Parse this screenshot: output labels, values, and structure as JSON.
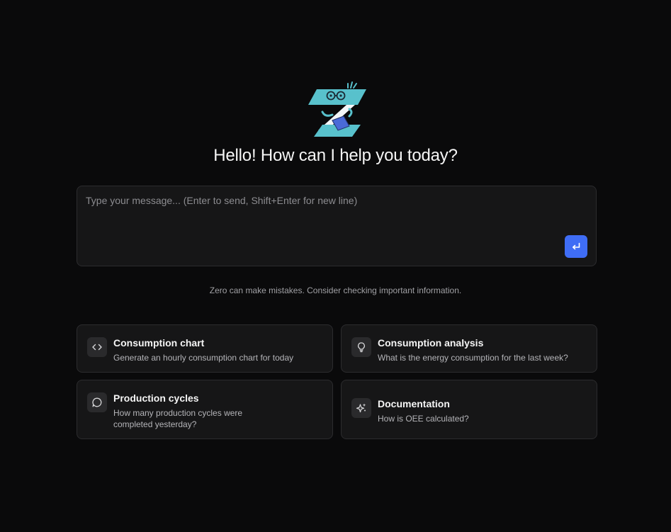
{
  "header": {
    "logo": "zero-mascot-logo",
    "greeting": "Hello! How can I help you today?"
  },
  "composer": {
    "placeholder": "Type your message... (Enter to send, Shift+Enter for new line)",
    "value": "",
    "send_icon": "enter-return-icon",
    "accent_color": "#3f6df5"
  },
  "disclaimer": "Zero can make mistakes. Consider checking important information.",
  "suggestions": [
    {
      "icon": "code-icon",
      "title": "Consumption chart",
      "subtitle": "Generate an hourly consumption chart for today"
    },
    {
      "icon": "lightbulb-icon",
      "title": "Consumption analysis",
      "subtitle": "What is the energy consumption for the last week?"
    },
    {
      "icon": "chat-bubble-icon",
      "title": "Production cycles",
      "subtitle_lines": [
        "How many production cycles were",
        "completed yesterday?"
      ]
    },
    {
      "icon": "sparkles-icon",
      "title": "Documentation",
      "subtitle": "How is OEE calculated?"
    }
  ]
}
